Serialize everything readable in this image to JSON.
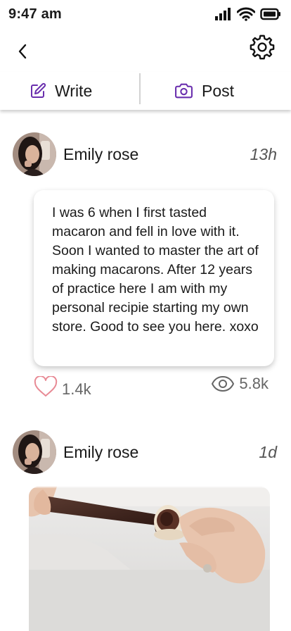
{
  "status": {
    "time": "9:47 am"
  },
  "actions": {
    "write_label": "Write",
    "post_label": "Post"
  },
  "posts": [
    {
      "author": "Emily rose",
      "time": "13h",
      "text": "I was 6 when I first tasted macaron and fell in love with it. Soon I wanted to  master the art of making macarons. After 12 years of practice here I am with my personal recipie starting my own store. Good to see you here. xoxo",
      "likes": "1.4k",
      "views": "5.8k"
    },
    {
      "author": "Emily rose",
      "time": "1d"
    }
  ],
  "colors": {
    "accent": "#6a2fae",
    "heart": "#e88a95",
    "muted": "#666666"
  }
}
